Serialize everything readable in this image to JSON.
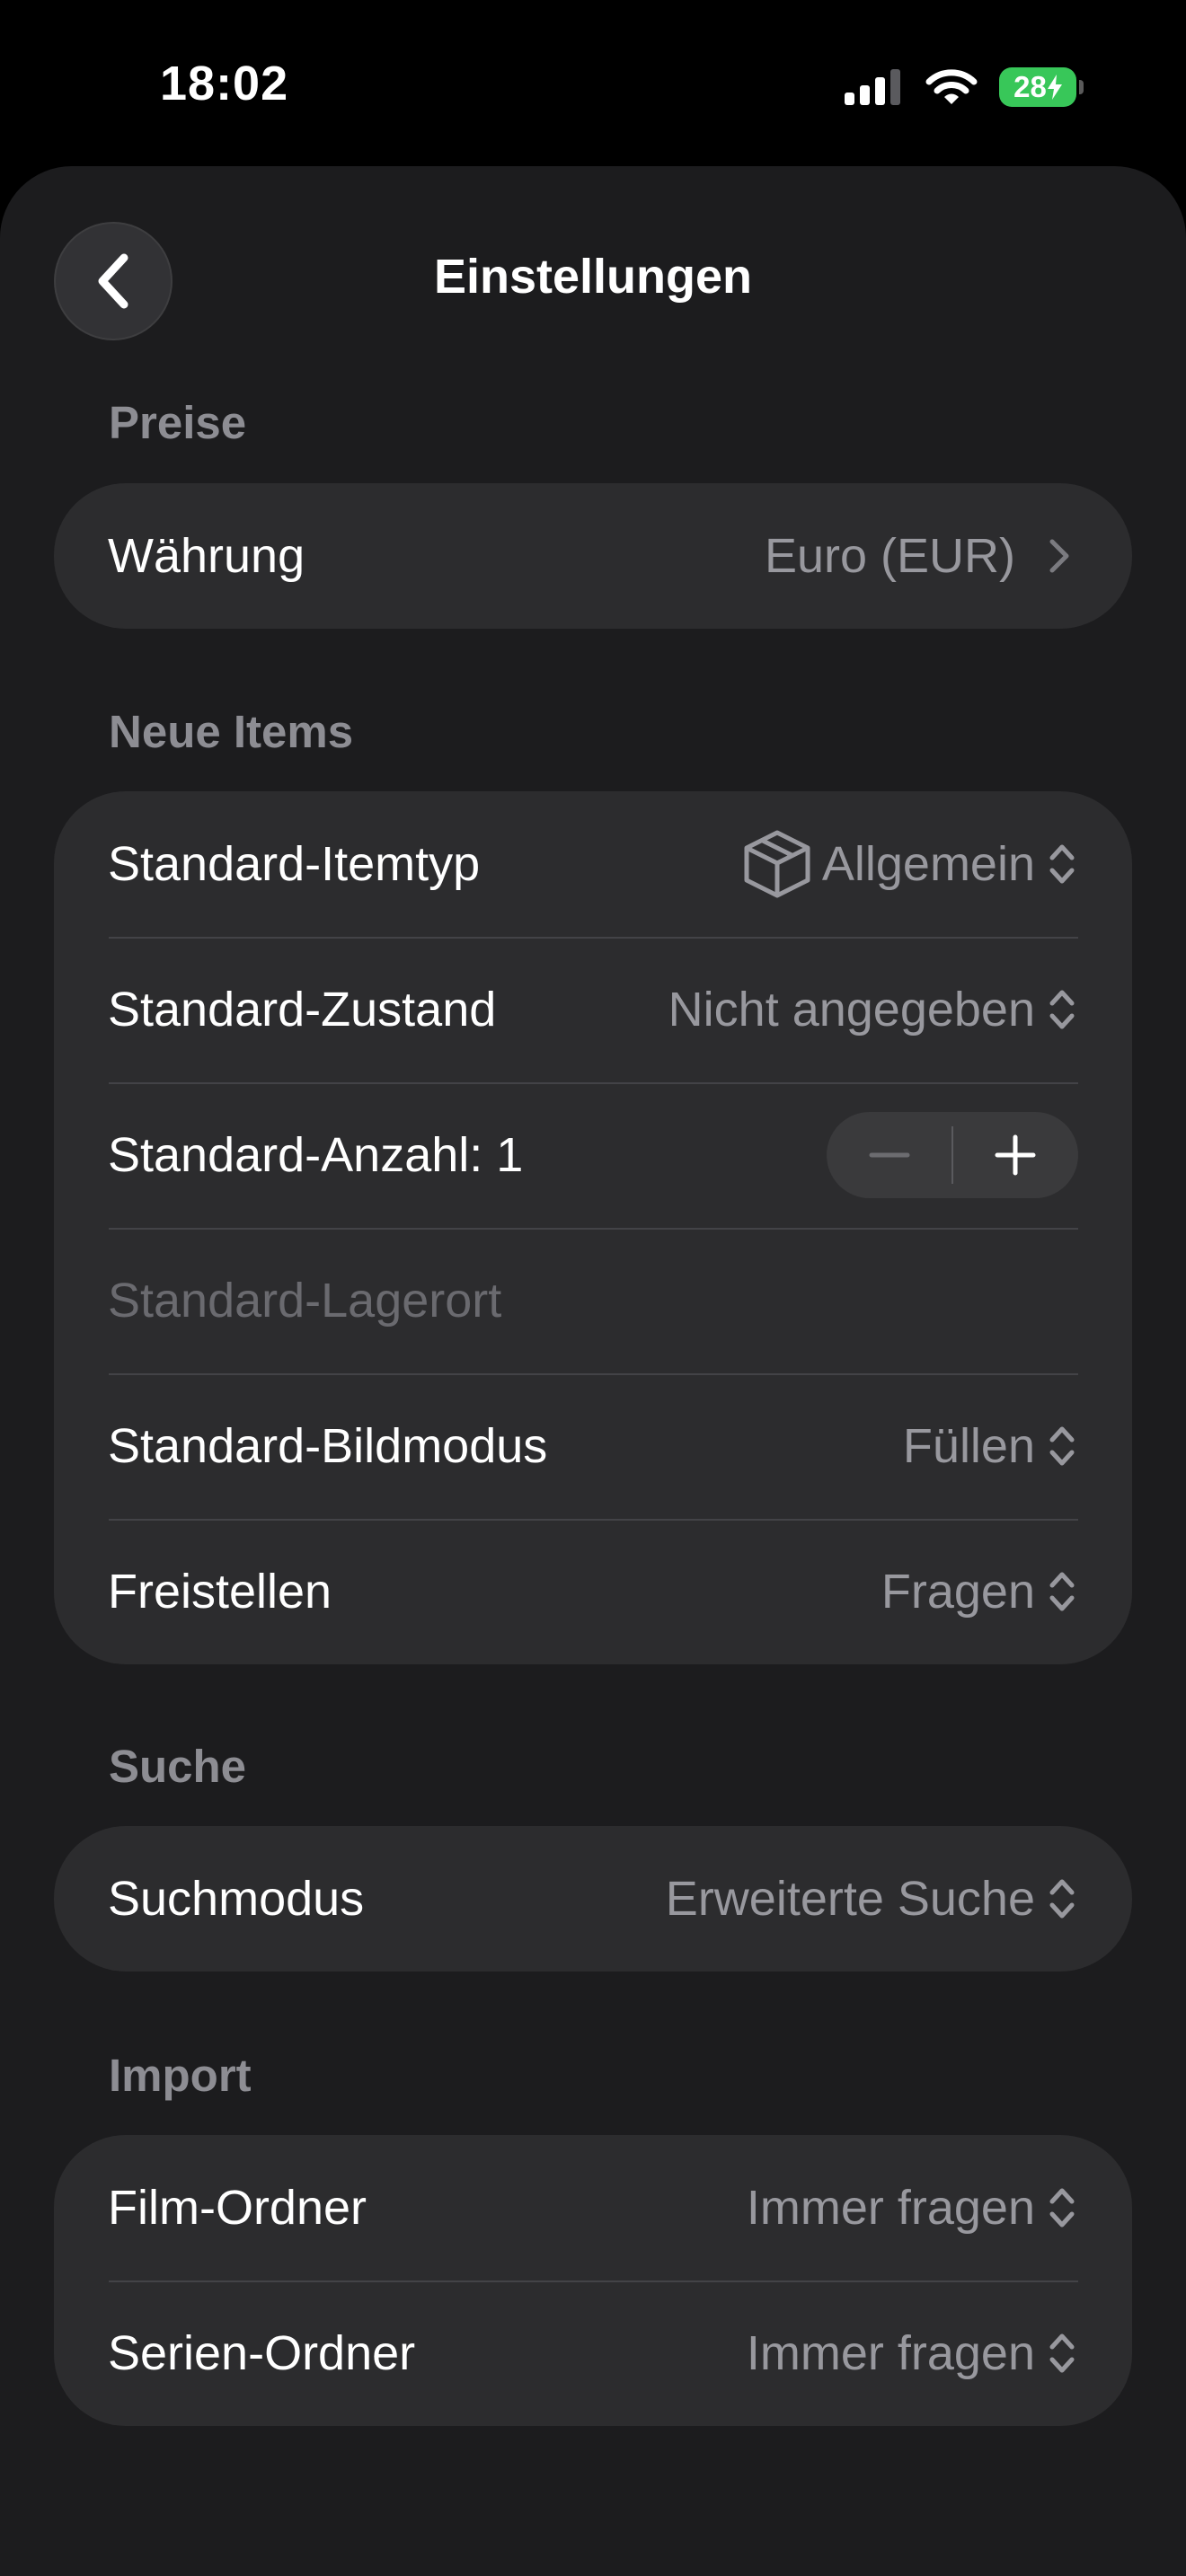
{
  "status": {
    "time": "18:02",
    "battery": "28"
  },
  "nav": {
    "title": "Einstellungen"
  },
  "sections": {
    "preise": {
      "header": "Preise",
      "currency_label": "Währung",
      "currency_value": "Euro (EUR)"
    },
    "neue_items": {
      "header": "Neue Items",
      "item_type_label": "Standard-Itemtyp",
      "item_type_value": "Allgemein",
      "condition_label": "Standard-Zustand",
      "condition_value": "Nicht angegeben",
      "quantity_label": "Standard-Anzahl: 1",
      "storage_placeholder": "Standard-Lagerort",
      "image_mode_label": "Standard-Bildmodus",
      "image_mode_value": "Füllen",
      "cutout_label": "Freistellen",
      "cutout_value": "Fragen"
    },
    "suche": {
      "header": "Suche",
      "search_mode_label": "Suchmodus",
      "search_mode_value": "Erweiterte Suche"
    },
    "import": {
      "header": "Import",
      "movie_folder_label": "Film-Ordner",
      "movie_folder_value": "Immer fragen",
      "series_folder_label": "Serien-Ordner",
      "series_folder_value": "Immer fragen"
    }
  },
  "colors": {
    "background": "#000000",
    "sheet": "#1c1c1e",
    "card": "#2c2c2e",
    "secondary_text": "#98989e",
    "battery": "#38c759"
  },
  "icons": {
    "back": "chevron-left-icon",
    "disclosure": "chevron-right-icon",
    "popup": "chevron-up-down-icon",
    "item_type": "cube-icon",
    "minus": "minus-icon",
    "plus": "plus-icon",
    "signal": "cellular-signal-icon",
    "wifi": "wifi-icon",
    "battery": "battery-charging-icon"
  }
}
